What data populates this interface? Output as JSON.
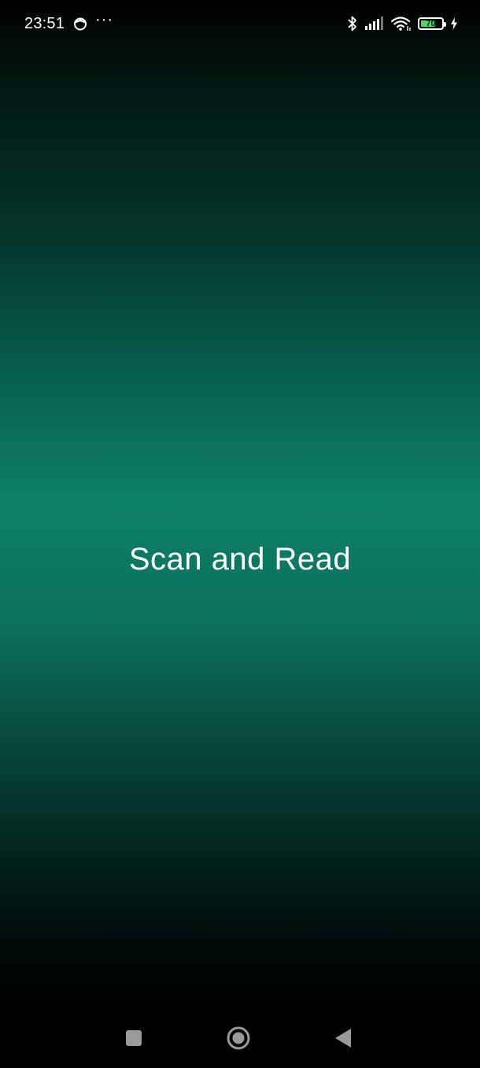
{
  "status_bar": {
    "time": "23:51",
    "notification_icon": "mi-face-icon",
    "more_indicator": "···",
    "icons": [
      "bluetooth-icon",
      "signal-icon",
      "wifi-icon",
      "battery-icon",
      "charging-icon"
    ],
    "battery_level": "70",
    "battery_fraction": 0.7,
    "battery_color": "#4cd964"
  },
  "splash": {
    "title": "Scan and Read",
    "gradient_accent": "#0d8068"
  },
  "nav_bar": {
    "buttons": [
      "recents-square-icon",
      "home-circle-icon",
      "back-triangle-icon"
    ]
  }
}
